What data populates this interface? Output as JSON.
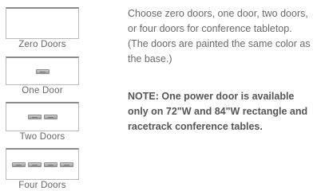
{
  "options": [
    {
      "label": "Zero Doors",
      "door_count": 0
    },
    {
      "label": "One Door",
      "door_count": 1
    },
    {
      "label": "Two Doors",
      "door_count": 2
    },
    {
      "label": "Four Doors",
      "door_count": 4
    }
  ],
  "description": "Choose zero doors, one door, two doors, or four doors for conference tabletop. (The doors are painted the same color as the base.)",
  "note": "NOTE: One power door is available only on 72\"W and 84\"W rectangle and racetrack conference tables.",
  "icons": {
    "door": "power-door-icon"
  }
}
